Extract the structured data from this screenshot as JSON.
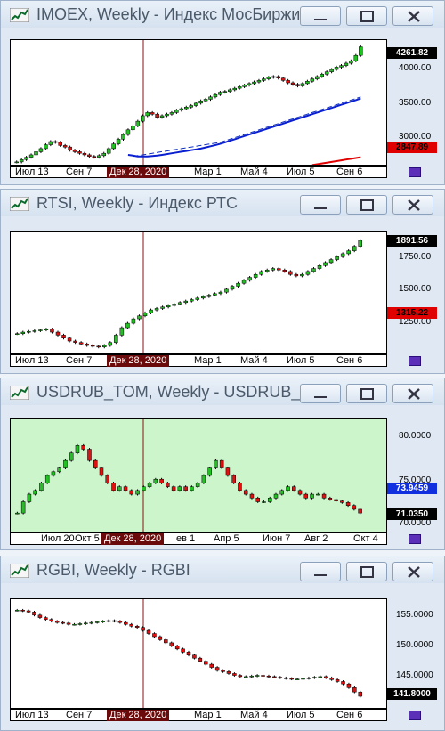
{
  "windows": [
    {
      "title": "IMOEX, Weekly - Индекс МосБиржи",
      "plot_bg": "#ffffff",
      "y_labels": [
        "4000.00",
        "3500.00",
        "3000.00"
      ],
      "last_price": "4261.82",
      "last_price_color": "#000000",
      "ma_price": "2847.89",
      "ma_price_color": "#e00000",
      "x_labels": [
        "Июл 13",
        "Сен 7",
        "Мар 1",
        "Май 4",
        "Июл 5",
        "Сен 6"
      ],
      "cursor_label": "Дек 28, 2020"
    },
    {
      "title": "RTSI, Weekly - Индекс РТС",
      "plot_bg": "#ffffff",
      "y_labels": [
        "1750.00",
        "1500.00",
        "1250.00"
      ],
      "last_price": "1891.56",
      "last_price_color": "#000000",
      "ma_price": "1315.22",
      "ma_price_color": "#e00000",
      "x_labels": [
        "Июл 13",
        "Сен 7",
        "Мар 1",
        "Май 4",
        "Июл 5",
        "Сен 6"
      ],
      "cursor_label": "Дек 28, 2020"
    },
    {
      "title": "USDRUB_TOM, Weekly - USDRUB_T...",
      "plot_bg": "#ccf5cc",
      "y_labels": [
        "80.0000",
        "75.0000",
        "70.0000"
      ],
      "last_price": "71.0350",
      "last_price_color": "#000000",
      "ma_price": "73.9459",
      "ma_price_color": "#1030e0",
      "x_labels": [
        "Июл 20",
        "Окт 5",
        "ев 1",
        "Апр 5",
        "Июн 7",
        "Авг 2",
        "Окт 4"
      ],
      "cursor_label": "Дек 28, 2020"
    },
    {
      "title": "RGBI, Weekly - RGBI",
      "plot_bg": "#ffffff",
      "y_labels": [
        "155.0000",
        "150.0000",
        "145.0000"
      ],
      "last_price": "141.8000",
      "last_price_color": "#000000",
      "ma_price": "",
      "ma_price_color": "",
      "x_labels": [
        "Июл 13",
        "Сен 7",
        "Мар 1",
        "Май 4",
        "Июл 5",
        "Сен 6"
      ],
      "cursor_label": "Дек 28, 2020"
    }
  ],
  "chart_data": [
    {
      "type": "candlestick",
      "title": "IMOEX, Weekly - Индекс МосБиржи",
      "ylim": [
        2800,
        4300
      ],
      "ticks": [
        4000,
        3500,
        3000
      ],
      "closes": [
        2790,
        2820,
        2850,
        2880,
        2920,
        2960,
        3010,
        3050,
        3040,
        3000,
        2980,
        2940,
        2920,
        2900,
        2880,
        2860,
        2850,
        2870,
        2900,
        2960,
        3020,
        3080,
        3140,
        3200,
        3250,
        3310,
        3380,
        3420,
        3400,
        3360,
        3380,
        3400,
        3420,
        3450,
        3470,
        3490,
        3510,
        3540,
        3570,
        3590,
        3620,
        3650,
        3680,
        3690,
        3710,
        3730,
        3750,
        3770,
        3790,
        3810,
        3830,
        3850,
        3870,
        3880,
        3860,
        3830,
        3800,
        3780,
        3760,
        3790,
        3820,
        3850,
        3880,
        3910,
        3940,
        3970,
        4000,
        4020,
        4050,
        4080,
        4150,
        4260
      ],
      "ma_dashed": [
        2860,
        2870,
        2880,
        2890,
        2900,
        2910,
        2920,
        2930,
        2940,
        2950,
        2960,
        2970,
        2980,
        2990,
        3000,
        3010,
        3020,
        3030,
        3040,
        3060,
        3080,
        3100,
        3120,
        3140,
        3160,
        3180,
        3200,
        3220,
        3240,
        3260,
        3280,
        3300,
        3320,
        3340,
        3360,
        3380,
        3400,
        3420,
        3440,
        3460,
        3480,
        3500,
        3520,
        3540,
        3560,
        3580,
        3600,
        3620
      ],
      "ma_solid": [
        2880,
        2870,
        2860,
        2860,
        2860,
        2865,
        2870,
        2880,
        2890,
        2900,
        2910,
        2920,
        2930,
        2940,
        2950,
        2960,
        2975,
        2990,
        3005,
        3020,
        3040,
        3060,
        3080,
        3100,
        3120,
        3140,
        3160,
        3180,
        3200,
        3220,
        3240,
        3260,
        3280,
        3300,
        3320,
        3340,
        3360,
        3380,
        3400,
        3420,
        3440,
        3460,
        3480,
        3500,
        3520,
        3540,
        3560,
        3580,
        3600
      ],
      "ma_red": [
        2750,
        2760,
        2770,
        2780,
        2790,
        2800,
        2810,
        2820,
        2830,
        2840,
        2850
      ]
    },
    {
      "type": "candlestick",
      "title": "RTSI, Weekly - Индекс РТС",
      "ylim": [
        1150,
        1920
      ],
      "ticks": [
        1750,
        1500,
        1250
      ],
      "closes": [
        1260,
        1270,
        1275,
        1280,
        1285,
        1290,
        1270,
        1250,
        1230,
        1210,
        1200,
        1190,
        1180,
        1175,
        1170,
        1180,
        1200,
        1250,
        1300,
        1330,
        1360,
        1380,
        1400,
        1420,
        1430,
        1440,
        1450,
        1460,
        1470,
        1480,
        1490,
        1500,
        1510,
        1520,
        1530,
        1540,
        1560,
        1580,
        1600,
        1620,
        1640,
        1660,
        1680,
        1690,
        1700,
        1690,
        1680,
        1660,
        1650,
        1660,
        1680,
        1700,
        1720,
        1740,
        1760,
        1780,
        1800,
        1820,
        1850,
        1890
      ]
    },
    {
      "type": "candlestick",
      "title": "USDRUB_TOM, Weekly - USDRUB_T...",
      "ylim": [
        69,
        83
      ],
      "ticks": [
        80,
        75,
        70
      ],
      "closes": [
        71,
        72.5,
        73.5,
        74,
        75,
        76,
        76.5,
        77,
        78,
        79,
        80,
        79.5,
        78,
        77,
        76,
        75,
        74,
        74.5,
        74,
        73.5,
        74,
        74.5,
        75,
        75.5,
        75,
        74.5,
        74,
        74.5,
        74,
        74.5,
        75,
        76,
        77,
        78,
        77,
        76,
        75,
        74,
        73.5,
        73,
        72.5,
        72.5,
        73,
        73.5,
        74,
        74.5,
        74,
        73.5,
        73,
        73.5,
        73.5,
        73,
        72.8,
        72.6,
        72.4,
        72,
        71.5,
        71
      ]
    },
    {
      "type": "candlestick",
      "title": "RGBI, Weekly - RGBI",
      "ylim": [
        140.5,
        157
      ],
      "ticks": [
        155,
        150,
        145
      ],
      "closes": [
        155.8,
        155.7,
        155.5,
        155,
        154.6,
        154.3,
        154,
        153.8,
        153.7,
        153.5,
        153.5,
        153.6,
        153.7,
        153.8,
        153.9,
        154,
        154.1,
        154,
        153.8,
        153.5,
        153.2,
        153,
        152.5,
        152,
        151.5,
        151,
        150.5,
        150,
        149.5,
        149,
        148.5,
        148,
        147.5,
        147,
        146.5,
        146,
        145.8,
        145.5,
        145.2,
        145,
        145,
        145.1,
        145.2,
        145.1,
        145,
        144.9,
        144.8,
        144.7,
        144.6,
        144.6,
        144.7,
        144.8,
        144.9,
        145,
        144.8,
        144.5,
        144.2,
        143.8,
        143.2,
        142.5,
        141.8
      ]
    }
  ]
}
